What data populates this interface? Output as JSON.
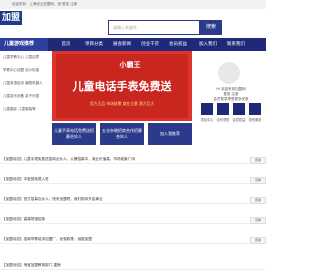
{
  "topbar": {
    "text": "欢迎来到 · 上海创业加盟网，请  登录  注册"
  },
  "logo": {
    "text": "加盟"
  },
  "search": {
    "placeholder": "请输入关键字",
    "button": "搜索"
  },
  "nav": {
    "category": "儿童游戏推荐",
    "items": [
      "首页",
      "项目分类",
      "展会新闻",
      "创业干货",
      "会员权益",
      "加入我们",
      "联系我们"
    ]
  },
  "sidebar": {
    "items": [
      "儿童早教中心  儿童启蒙",
      "早教中心加盟  幼小衔接",
      "儿童英语培训  编程机器人",
      "儿童游乐设备  亲子乐园",
      "儿童摄影  儿童服装等"
    ]
  },
  "banner": {
    "brand": "小霸王",
    "title": "儿童电话手表免费送",
    "tags": "官方正品   市场前景   商业立意   潜力巨大"
  },
  "buttons": [
    "儿童手表电话免费送招募合伙人",
    "五谷杂粮招商合作招募合伙人",
    "加入我推荐"
  ],
  "right_panel": {
    "line1": "Hi 欢迎来到加盟网",
    "line2": "登录 注册",
    "line3": "会员登录享受更多优惠",
    "icons": [
      "项目中心",
      "合作须知",
      "会员权益",
      "投资服务"
    ]
  },
  "news": [
    {
      "tag": "【加盟动态】",
      "title": "儿童手表免费送招商合伙人，火爆招募中，商业价值高，市场前景广阔",
      "date": "09-12"
    },
    {
      "tag": "【加盟动态】",
      "title": "中医馆免费入驻",
      "date": "09-12"
    },
    {
      "tag": "【加盟动态】",
      "title": "官方招募合伙人，快来加盟吧，我们助你开启事业",
      "date": "09-12"
    },
    {
      "tag": "【加盟动态】",
      "title": "高端场馆招商",
      "date": "09-12"
    },
    {
      "tag": "【加盟动态】",
      "title": "招商早教培训加盟厂，优惠政策，诚邀加盟",
      "date": "09-12"
    },
    {
      "tag": "【加盟动态】",
      "title": "淘宝加盟教育部门 重磅",
      "date": "09-12"
    }
  ],
  "news_button": "查看"
}
